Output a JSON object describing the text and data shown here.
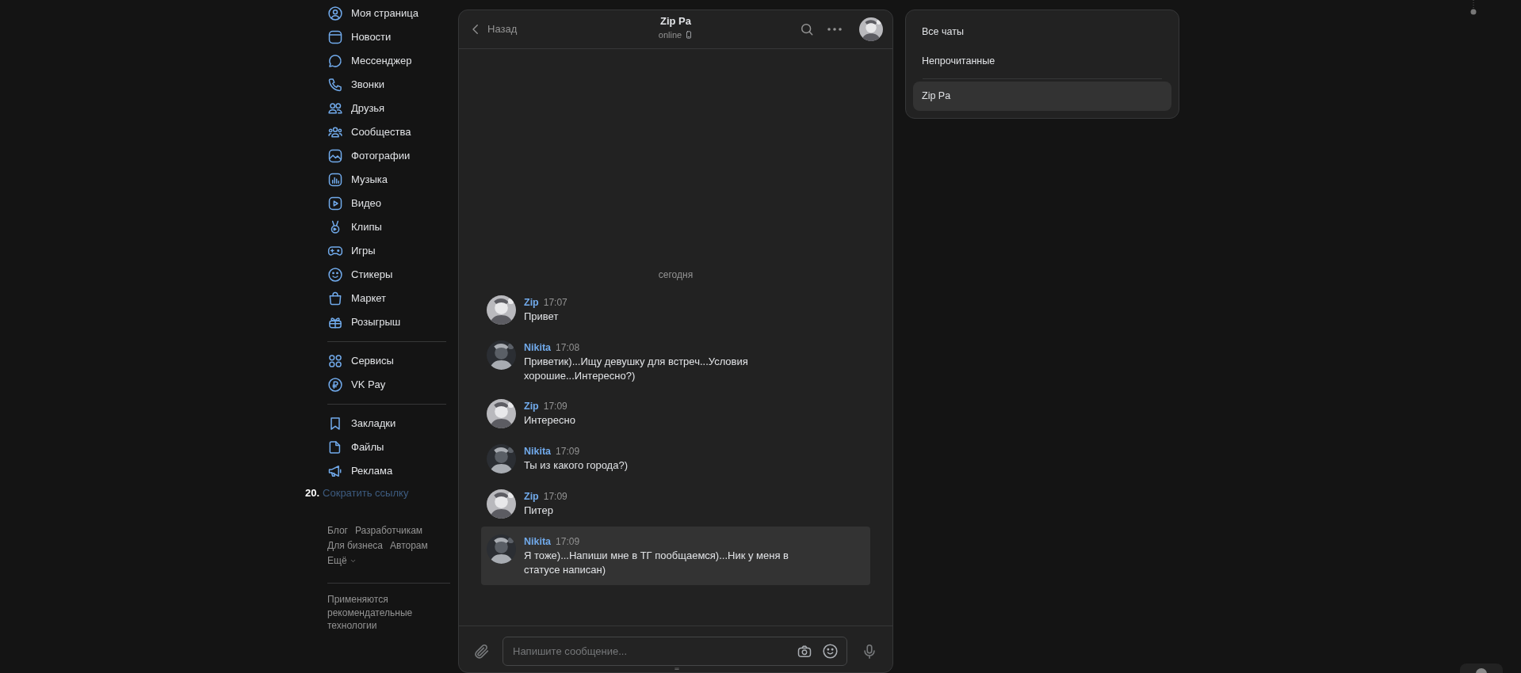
{
  "sidebar": {
    "groups": [
      [
        {
          "label": "Моя страница"
        },
        {
          "label": "Новости"
        },
        {
          "label": "Мессенджер"
        },
        {
          "label": "Звонки"
        },
        {
          "label": "Друзья"
        },
        {
          "label": "Сообщества"
        },
        {
          "label": "Фотографии"
        },
        {
          "label": "Музыка"
        },
        {
          "label": "Видео"
        },
        {
          "label": "Клипы"
        },
        {
          "label": "Игры"
        },
        {
          "label": "Стикеры"
        },
        {
          "label": "Маркет"
        },
        {
          "label": "Розыгрыш"
        }
      ],
      [
        {
          "label": "Сервисы"
        },
        {
          "label": "VK Pay"
        }
      ],
      [
        {
          "label": "Закладки"
        },
        {
          "label": "Файлы"
        },
        {
          "label": "Реклама"
        }
      ]
    ],
    "shortcut": {
      "number": "20.",
      "link": "Сократить ссылку"
    },
    "footer_links": [
      "Блог",
      "Разработчикам",
      "Для бизнеса",
      "Авторам",
      "Ещё"
    ],
    "footer_note": "Применяются рекомендательные технологии"
  },
  "chat": {
    "back": "Назад",
    "title": "Zip Pa",
    "status": "online",
    "date": "сегодня",
    "messages": [
      {
        "author": "Zip",
        "time": "17:07",
        "text": "Привет",
        "highlighted": false,
        "kind": "light"
      },
      {
        "author": "Nikita",
        "time": "17:08",
        "text": "Приветик)...Ищу девушку для встреч...Условия хорошие...Интересно?)",
        "highlighted": false,
        "kind": "dark"
      },
      {
        "author": "Zip",
        "time": "17:09",
        "text": "Интересно",
        "highlighted": false,
        "kind": "light"
      },
      {
        "author": "Nikita",
        "time": "17:09",
        "text": "Ты из какого города?)",
        "highlighted": false,
        "kind": "dark"
      },
      {
        "author": "Zip",
        "time": "17:09",
        "text": "Питер",
        "highlighted": false,
        "kind": "light"
      },
      {
        "author": "Nikita",
        "time": "17:09",
        "text": "Я тоже)...Напиши мне в ТГ пообщаемся)...Ник у меня в статусе написан)",
        "highlighted": true,
        "kind": "dark"
      }
    ],
    "composer": {
      "placeholder": "Напишите сообщение..."
    }
  },
  "folders": {
    "filters": [
      {
        "label": "Все чаты",
        "selected": false
      },
      {
        "label": "Непрочитанные",
        "selected": false
      }
    ],
    "chats": [
      {
        "label": "Zip Pa",
        "selected": true
      }
    ]
  }
}
